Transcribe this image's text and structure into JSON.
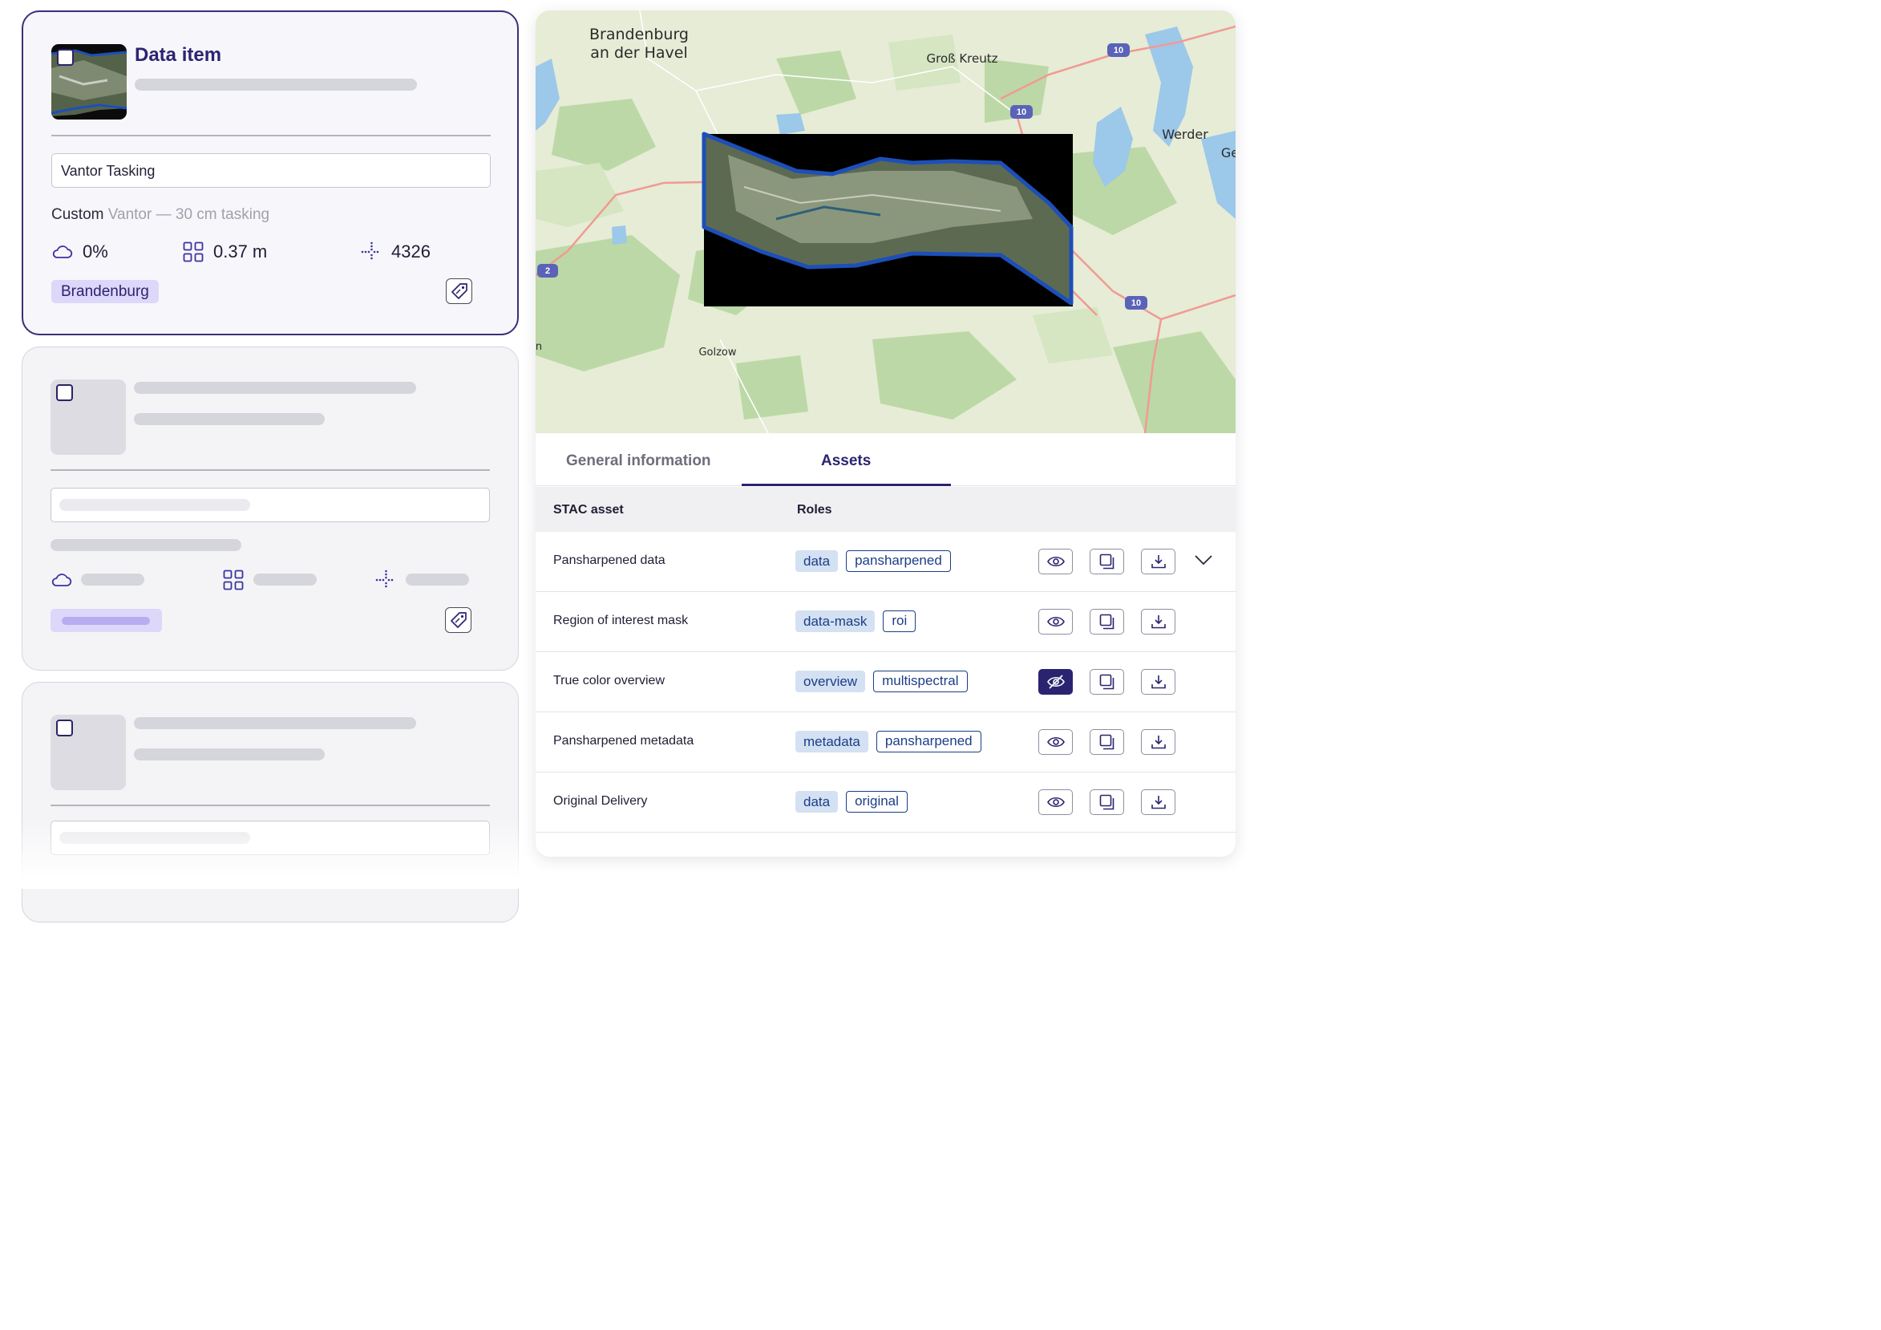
{
  "card": {
    "title": "Data item",
    "field_value": "Vantor Tasking",
    "meta_key": "Custom",
    "meta_value": "Vantor — 30 cm tasking",
    "cloud_cover": "0%",
    "resolution": "0.37 m",
    "pixel_count": "4326",
    "tag": "Brandenburg"
  },
  "map": {
    "labels": [
      "Brandenburg",
      "an der Havel",
      "Groß Kreutz",
      "Werder",
      "Ge",
      "Golzow",
      "n"
    ],
    "road_shields": [
      "10",
      "10",
      "10",
      "2"
    ]
  },
  "tabs": [
    {
      "label": "General information"
    },
    {
      "label": "Assets"
    }
  ],
  "table": {
    "headers": [
      "STAC asset",
      "Roles"
    ],
    "rows": [
      {
        "name": "Pansharpened data",
        "roles": [
          "data",
          "pansharpened"
        ]
      },
      {
        "name": "Region of interest mask",
        "roles": [
          "data-mask",
          "roi"
        ]
      },
      {
        "name": "True color overview",
        "roles": [
          "overview",
          "multispectral"
        ]
      },
      {
        "name": "Pansharpened metadata",
        "roles": [
          "metadata",
          "pansharpened"
        ]
      },
      {
        "name": "Original Delivery",
        "roles": [
          "data",
          "original"
        ]
      }
    ]
  },
  "icons": [
    "checkbox-icon",
    "cloud-icon",
    "grid-icon",
    "crosshair-icon",
    "tag-icon",
    "eye-icon",
    "eye-off-icon",
    "copy-icon",
    "download-icon",
    "chevron-down-icon"
  ],
  "colors": {
    "accent": "#2a2470",
    "role_fill": "#d4e1f3",
    "role_text": "#1b3e86",
    "tag_bg": "#ddd7fa",
    "footprint": "#1d4fb8"
  }
}
